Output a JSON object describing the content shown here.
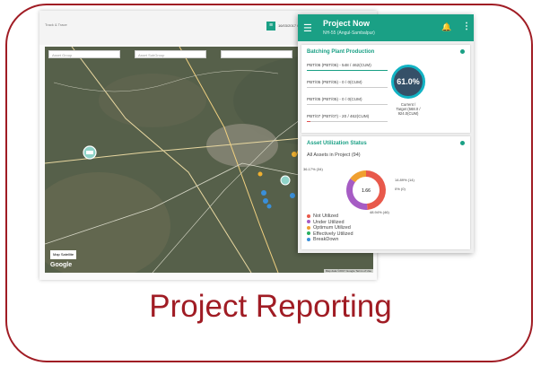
{
  "caption": "Project Reporting",
  "colors": {
    "brand": "#a01c24",
    "teal": "#1aa085",
    "map": "#5b6350"
  },
  "topbar": {
    "crumb": "Track & Trace",
    "datetime": "16/03/2017 00:00 - 07/03/2017 00:00"
  },
  "map": {
    "filters": [
      "Asset Group",
      "Asset SubGroup",
      ""
    ],
    "controls": [
      "▶",
      "⏮",
      "⏸",
      "⏭",
      "☰"
    ],
    "map_type": "Map  Satellite",
    "brand": "Google",
    "attribution": "Map data ©2017 Google  Terms of Use",
    "marker_icons": [
      "truck-marker-icon",
      "crane-marker-icon",
      "excavator-marker-icon",
      "plant-marker-icon"
    ]
  },
  "panel": {
    "title": "Project Now",
    "subtitle": "NH-55 (Angul-Sambalpur)",
    "icons": [
      "menu-icon",
      "bell-icon",
      "more-vertical-icon"
    ],
    "batching": {
      "title": "Batching Plant Production",
      "rows": [
        {
          "label": "PBT/06 (PBT/06) - 548 / 462(CUM)",
          "progress": 1.0,
          "color": "#1aa085"
        },
        {
          "label": "PBT/05 (PBT/05) - 0 / 0(CUM)",
          "progress": 0,
          "color": "#1aa085"
        },
        {
          "label": "PBT/05 (PBT/05) - 0 / 0(CUM)",
          "progress": 0,
          "color": "#1aa085"
        },
        {
          "label": "PBT/07 (PBT/07) - 20 / 462(CUM)",
          "progress": 0.04,
          "color": "#e05050"
        }
      ],
      "gauge": "61.0%",
      "gauge_caption_1": "Current /",
      "gauge_caption_2": "Target (568.0 /",
      "gauge_caption_3": "924.0(CUM)"
    },
    "utilization": {
      "title": "Asset Utilization Status",
      "all_assets": "All Assets in Project (94)",
      "center_value": "1.66",
      "labels": {
        "under": "36.17% (34)",
        "optimum": "14.89% (14)",
        "effective": "0% (0)",
        "not": "48.94% (46)"
      },
      "chart_data": {
        "type": "pie",
        "categories": [
          "Not Utilized",
          "Under Utilized",
          "Optimum Utilized",
          "Effectively Utilized",
          "BreakDown"
        ],
        "values": [
          46,
          34,
          14,
          0,
          0
        ],
        "colors": [
          "#e8594b",
          "#a65cc4",
          "#f0a030",
          "#27ae60",
          "#3a8fd8"
        ]
      },
      "legend": [
        "Not Utilized",
        "Under Utilized",
        "Optimum Utilized",
        "Effectively Utilized",
        "BreakDown"
      ]
    }
  }
}
